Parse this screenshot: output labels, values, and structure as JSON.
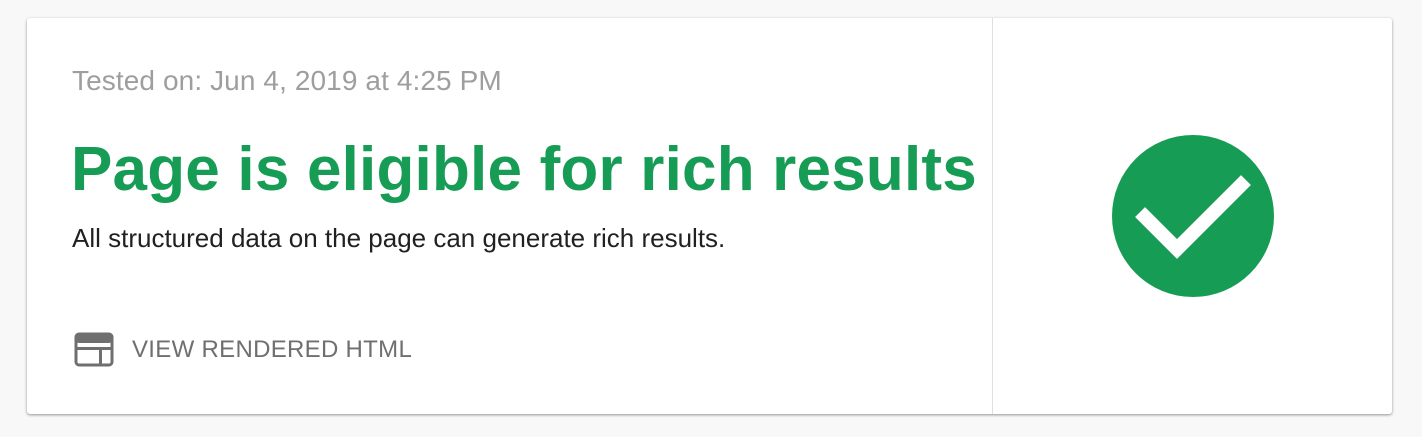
{
  "result": {
    "tested_on": "Tested on: Jun 4, 2019 at 4:25 PM",
    "title": "Page is eligible for rich results",
    "description": "All structured data on the page can generate rich results.",
    "view_rendered_html_label": "VIEW RENDERED HTML",
    "status_icon": "check-circle-icon",
    "link_icon": "web-page-icon"
  },
  "colors": {
    "accent": "#169c55",
    "muted": "#9e9e9e",
    "text": "#212121",
    "link": "#6f6f6f"
  }
}
